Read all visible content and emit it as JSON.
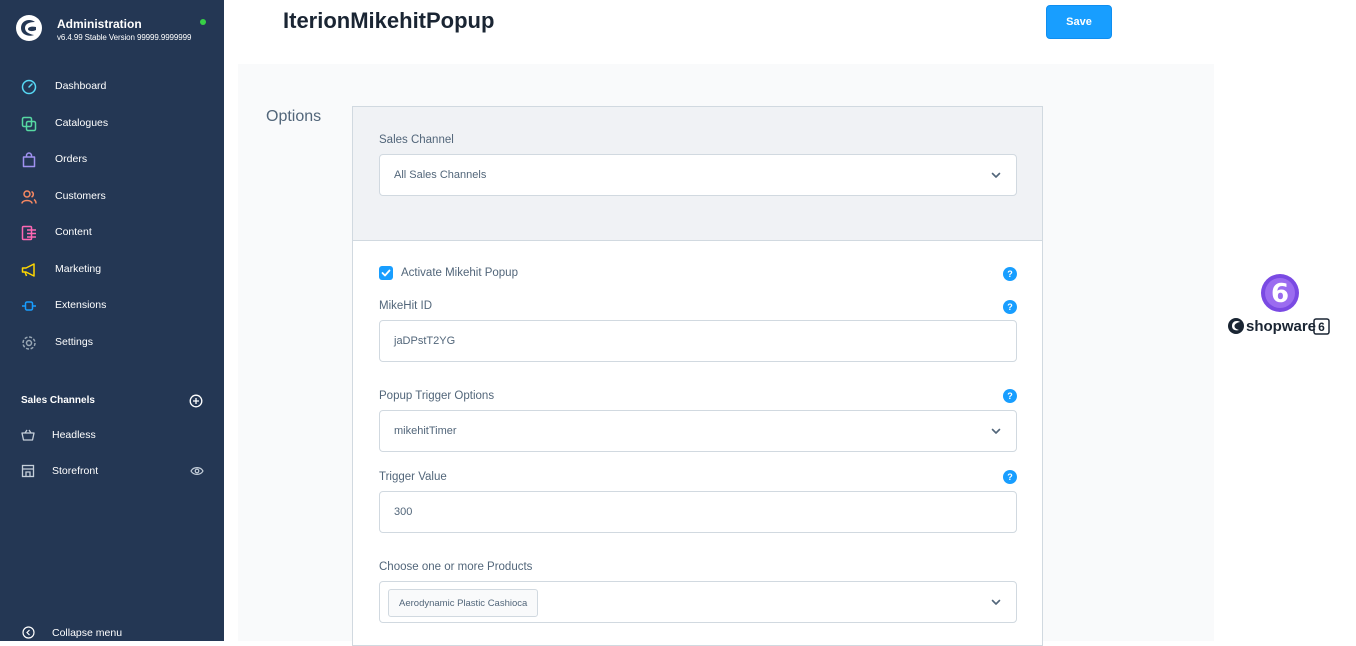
{
  "app": {
    "title": "Administration",
    "version": "v6.4.99 Stable Version 99999.9999999",
    "status_color": "#37d046"
  },
  "sidebar": {
    "items": [
      {
        "label": "Dashboard",
        "icon": "dashboard-icon",
        "color": "#57d9f5"
      },
      {
        "label": "Catalogues",
        "icon": "catalogue-icon",
        "color": "#57d9a3"
      },
      {
        "label": "Orders",
        "icon": "bag-icon",
        "color": "#a092f0"
      },
      {
        "label": "Customers",
        "icon": "users-icon",
        "color": "#f88962"
      },
      {
        "label": "Content",
        "icon": "content-icon",
        "color": "#ff68b4"
      },
      {
        "label": "Marketing",
        "icon": "megaphone-icon",
        "color": "#ffd700"
      },
      {
        "label": "Extensions",
        "icon": "plug-icon",
        "color": "#189eff"
      },
      {
        "label": "Settings",
        "icon": "gear-icon",
        "color": "#9aa8b5"
      }
    ],
    "sales_channels": {
      "header": "Sales Channels",
      "items": [
        {
          "label": "Headless",
          "icon": "basket-icon"
        },
        {
          "label": "Storefront",
          "icon": "storefront-icon"
        }
      ]
    },
    "collapse_label": "Collapse menu"
  },
  "header": {
    "title": "IterionMikehitPopup",
    "save_label": "Save"
  },
  "main": {
    "section_title": "Options",
    "sales_channel": {
      "label": "Sales Channel",
      "value": "All Sales Channels"
    },
    "activate": {
      "label": "Activate Mikehit Popup",
      "checked": true
    },
    "mikehit_id": {
      "label": "MikeHit ID",
      "value": "jaDPstT2YG"
    },
    "trigger_options": {
      "label": "Popup Trigger Options",
      "value": "mikehitTimer"
    },
    "trigger_value": {
      "label": "Trigger Value",
      "value": "300"
    },
    "products": {
      "label": "Choose one or more Products",
      "selected": [
        "Aerodynamic Plastic Cashioca"
      ]
    },
    "help_glyph": "?"
  },
  "badge": {
    "number": "6",
    "brand": "shopware",
    "brand_number": "6",
    "color": "#7a4ae3"
  }
}
